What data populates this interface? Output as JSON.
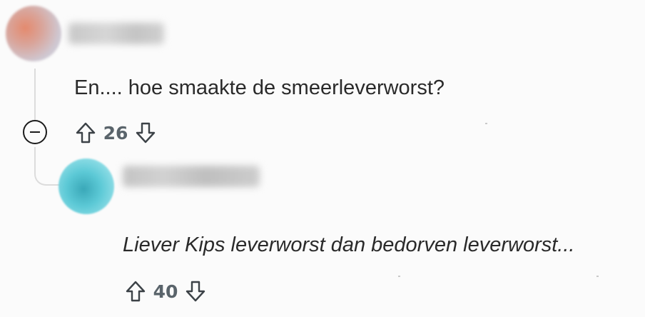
{
  "comment": {
    "username": "",
    "text": "En.... hoe smaakte de smeerleverworst?",
    "votes": "26",
    "upvote_icon": "arrow-up-outline-icon",
    "downvote_icon": "arrow-down-outline-icon",
    "collapse_icon": "minus-circle-icon"
  },
  "reply": {
    "username": "",
    "text": "Liever Kips leverworst dan bedorven leverworst...",
    "votes": "40",
    "upvote_icon": "arrow-up-outline-icon",
    "downvote_icon": "arrow-down-outline-icon"
  },
  "colors": {
    "background": "#fbfbfb",
    "text": "#2a2a2a",
    "vote_count": "#5a646b",
    "thread_line": "#dcdcdc"
  }
}
